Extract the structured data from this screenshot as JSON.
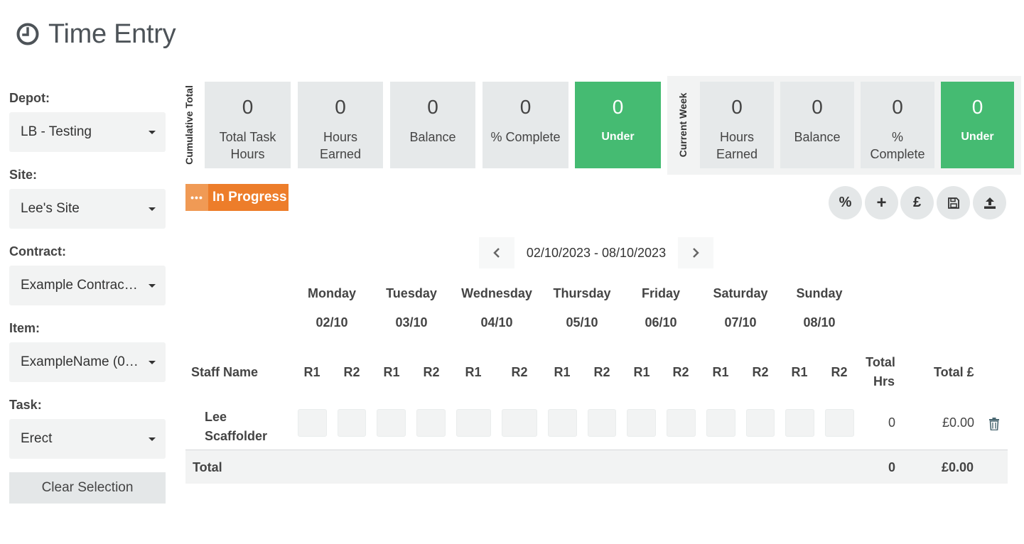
{
  "page": {
    "title": "Time Entry",
    "icon": "clock-icon"
  },
  "sidebar": {
    "fields": [
      {
        "label": "Depot:",
        "value": "LB - Testing"
      },
      {
        "label": "Site:",
        "value": "Lee's Site"
      },
      {
        "label": "Contract:",
        "value": "Example Contract (6..."
      },
      {
        "label": "Item:",
        "value": "ExampleName (011)"
      },
      {
        "label": "Task:",
        "value": "Erect"
      }
    ],
    "clear_label": "Clear Selection"
  },
  "cumulative": {
    "label": "Cumulative Total",
    "cards": [
      {
        "value": "0",
        "label": "Total Task Hours"
      },
      {
        "value": "0",
        "label": "Hours Earned"
      },
      {
        "value": "0",
        "label": "Balance"
      },
      {
        "value": "0",
        "label": "% Complete"
      },
      {
        "value": "0",
        "label": "Under",
        "highlight": true
      }
    ]
  },
  "current_week": {
    "label": "Current Week",
    "cards": [
      {
        "value": "0",
        "label": "Hours Earned"
      },
      {
        "value": "0",
        "label": "Balance"
      },
      {
        "value": "0",
        "label": "% Complete"
      },
      {
        "value": "0",
        "label": "Under",
        "highlight": true
      }
    ]
  },
  "status": {
    "label": "In Progress",
    "icon": "ellipsis-icon",
    "color": "#ed7d2a"
  },
  "tools": [
    {
      "name": "percent-button",
      "glyph": "%"
    },
    {
      "name": "add-button",
      "glyph": "+"
    },
    {
      "name": "pound-button",
      "glyph": "£"
    },
    {
      "name": "save-button",
      "glyph": ""
    },
    {
      "name": "upload-button",
      "glyph": ""
    }
  ],
  "week": {
    "range": "02/10/2023 - 08/10/2023"
  },
  "days": [
    {
      "name": "Monday",
      "date": "02/10"
    },
    {
      "name": "Tuesday",
      "date": "03/10"
    },
    {
      "name": "Wednesday",
      "date": "04/10"
    },
    {
      "name": "Thursday",
      "date": "05/10"
    },
    {
      "name": "Friday",
      "date": "06/10"
    },
    {
      "name": "Saturday",
      "date": "07/10"
    },
    {
      "name": "Sunday",
      "date": "08/10"
    }
  ],
  "table": {
    "headers": {
      "staff": "Staff Name",
      "r1": "R1",
      "r2": "R2",
      "total_hrs_1": "Total",
      "total_hrs_2": "Hrs",
      "total_gbp": "Total £"
    },
    "rows": [
      {
        "name_1": "Lee",
        "name_2": "Scaffolder",
        "total_hrs": "0",
        "total_gbp": "£0.00"
      }
    ],
    "totals": {
      "label": "Total",
      "hrs": "0",
      "gbp": "£0.00"
    }
  },
  "colors": {
    "green": "#45bb72",
    "orange": "#ed7d2a",
    "card_bg": "#e6e9ea"
  }
}
